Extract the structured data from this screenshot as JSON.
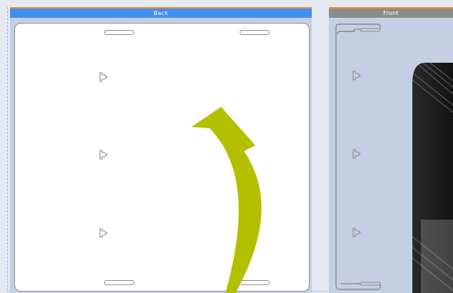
{
  "panels": {
    "back": {
      "title": "Back"
    },
    "front": {
      "title": "Front"
    }
  },
  "colors": {
    "back_header": "#3f8ff0",
    "front_header": "#8c8c8c",
    "accent": "#f08a2a",
    "panel_bg": "#c5cfe3",
    "arrow": "#b3c000"
  },
  "icons": {
    "clip": "clip-tab-icon",
    "slot": "tab-slot",
    "arrow": "curved-arrow-icon"
  }
}
